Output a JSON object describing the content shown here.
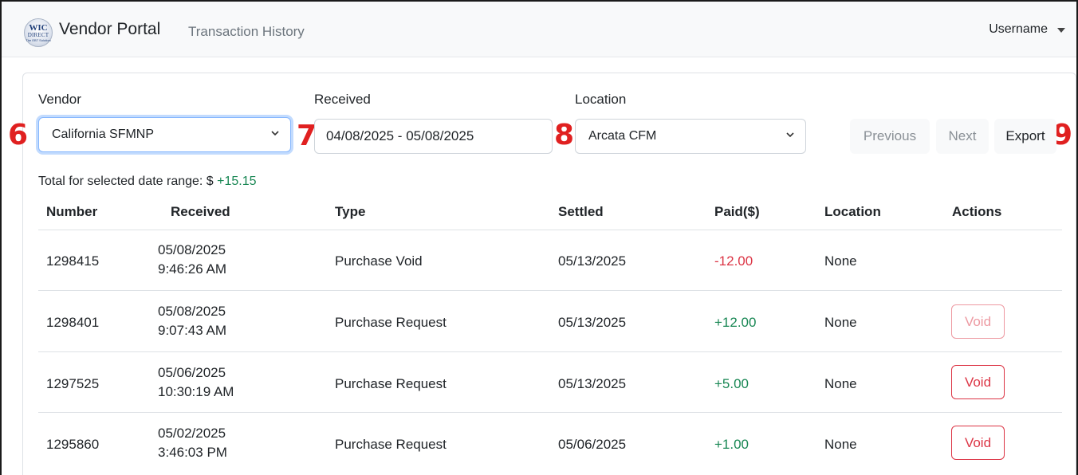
{
  "navbar": {
    "logo_text": [
      "WIC",
      "DIRECT",
      "The EBT Solution"
    ],
    "brand": "Vendor Portal",
    "page_title": "Transaction History",
    "username": "Username"
  },
  "filters": {
    "vendor_label": "Vendor",
    "vendor_value": "California SFMNP",
    "received_label": "Received",
    "received_value": "04/08/2025 - 05/08/2025",
    "location_label": "Location",
    "location_value": "Arcata CFM"
  },
  "buttons": {
    "previous": "Previous",
    "next": "Next",
    "export": "Export"
  },
  "markers": [
    "6",
    "7",
    "8",
    "9"
  ],
  "total": {
    "label": "Total for selected date range: $",
    "amount": "+15.15"
  },
  "table": {
    "headers": [
      "Number",
      "Received",
      "Type",
      "Settled",
      "Paid($)",
      "Location",
      "Actions"
    ],
    "rows": [
      {
        "number": "1298415",
        "received_date": "05/08/2025",
        "received_time": "9:46:26 AM",
        "type": "Purchase Void",
        "settled": "05/13/2025",
        "paid": "-12.00",
        "location": "None",
        "action": ""
      },
      {
        "number": "1298401",
        "received_date": "05/08/2025",
        "received_time": "9:07:43 AM",
        "type": "Purchase Request",
        "settled": "05/13/2025",
        "paid": "+12.00",
        "location": "None",
        "action": "Void"
      },
      {
        "number": "1297525",
        "received_date": "05/06/2025",
        "received_time": "10:30:19 AM",
        "type": "Purchase Request",
        "settled": "05/13/2025",
        "paid": "+5.00",
        "location": "None",
        "action": "Void"
      },
      {
        "number": "1295860",
        "received_date": "05/02/2025",
        "received_time": "3:46:03 PM",
        "type": "Purchase Request",
        "settled": "05/06/2025",
        "paid": "+1.00",
        "location": "None",
        "action": "Void"
      }
    ]
  },
  "colors": {
    "negative": "#dc3545",
    "positive": "#198754",
    "marker": "#e02020",
    "focus": "#86b7fe"
  }
}
